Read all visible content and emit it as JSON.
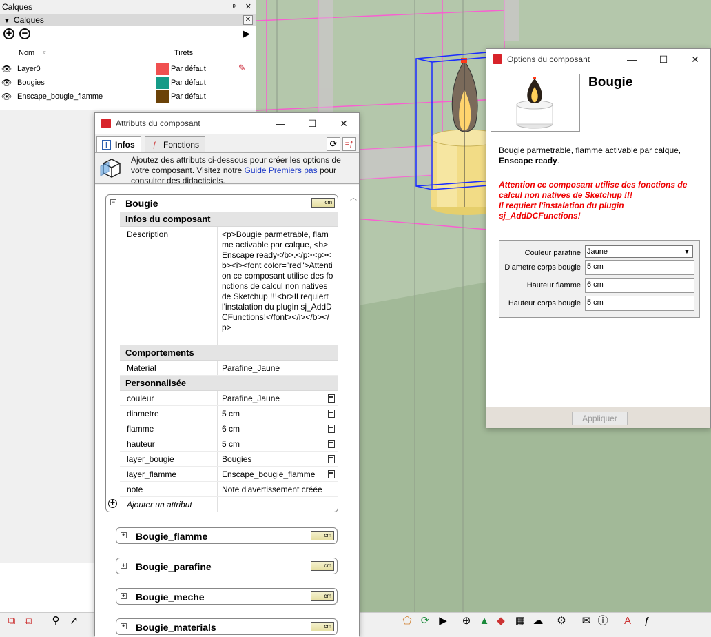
{
  "layers_panel": {
    "title": "Calques",
    "pin_glyph": "ᵖ",
    "close_glyph": "✕",
    "section_title": "Calques",
    "columns": {
      "name": "Nom",
      "dashes": "Tirets"
    },
    "layers": [
      {
        "name": "Layer0",
        "color": "#f05050",
        "dashes": "Par défaut"
      },
      {
        "name": "Bougies",
        "color": "#159b87",
        "dashes": "Par défaut"
      },
      {
        "name": "Enscape_bougie_flamme",
        "color": "#6b4208",
        "dashes": "Par défaut"
      }
    ]
  },
  "attributes_window": {
    "title": "Attributs du composant",
    "tabs": [
      {
        "label": "Infos"
      },
      {
        "label": "Fonctions"
      }
    ],
    "info_text": "Ajoutez des attributs ci-dessous pour créer les options de votre composant. Visitez notre",
    "info_link": "Guide Premiers pas",
    "info_text_after": "pour consulter des didacticiels.",
    "unit_badge": "cm",
    "component": {
      "name": "Bougie",
      "groups": {
        "infos": "Infos du composant",
        "behaviors": "Comportements",
        "custom": "Personnalisée"
      },
      "description_label": "Description",
      "description_value": "<p>Bougie parmetrable, flamme activable par calque, <b>Enscape ready</b>.</p><p><b><i><font color=\"red\">Attention ce composant utilise des fonctions de calcul non natives de Sketchup !!!<br>Il requiert l'instalation du plugin sj_AddDCFunctions!</font></i></b></p>",
      "material_label": "Material",
      "material_value": "Parafine_Jaune",
      "custom_attributes": [
        {
          "key": "couleur",
          "value": "Parafine_Jaune",
          "has_formula_btn": true
        },
        {
          "key": "diametre",
          "value": "5 cm",
          "has_formula_btn": true
        },
        {
          "key": "flamme",
          "value": "6 cm",
          "has_formula_btn": true
        },
        {
          "key": "hauteur",
          "value": "5 cm",
          "has_formula_btn": true
        },
        {
          "key": "layer_bougie",
          "value": "Bougies",
          "has_formula_btn": true
        },
        {
          "key": "layer_flamme",
          "value": "Enscape_bougie_flamme",
          "has_formula_btn": true
        },
        {
          "key": "note",
          "value": "Note d'avertissement créée",
          "has_formula_btn": false
        }
      ],
      "add_attribute": "Ajouter un attribut"
    },
    "subcomponents": [
      {
        "name": "Bougie_flamme"
      },
      {
        "name": "Bougie_parafine"
      },
      {
        "name": "Bougie_meche"
      },
      {
        "name": "Bougie_materials"
      }
    ]
  },
  "options_window": {
    "title": "Options du composant",
    "component_name": "Bougie",
    "description_plain": "Bougie parmetrable, flamme activable par calque,",
    "description_bold": "Enscape ready",
    "description_end": ".",
    "warning_line1": "Attention ce composant utilise des fonctions de calcul non natives de Sketchup !!!",
    "warning_line2": "Il requiert l'instalation du plugin sj_AddDCFunctions!",
    "fields": [
      {
        "label": "Couleur parafine",
        "value": "Jaune",
        "type": "select"
      },
      {
        "label": "Diametre corps bougie",
        "value": "5 cm",
        "type": "text"
      },
      {
        "label": "Hauteur flamme",
        "value": "6 cm",
        "type": "text"
      },
      {
        "label": "Hauteur corps bougie",
        "value": "5 cm",
        "type": "text"
      }
    ],
    "apply_label": "Appliquer"
  },
  "window_controls": {
    "minimize": "—",
    "maximize": "☐",
    "close": "✕"
  },
  "colors": {
    "viewport_bg": "#aebfa4",
    "selection_blue": "#1a2cff",
    "highlight_pink": "#ff4fd0",
    "warning_red": "#e00000",
    "link_blue": "#1a37c6"
  }
}
